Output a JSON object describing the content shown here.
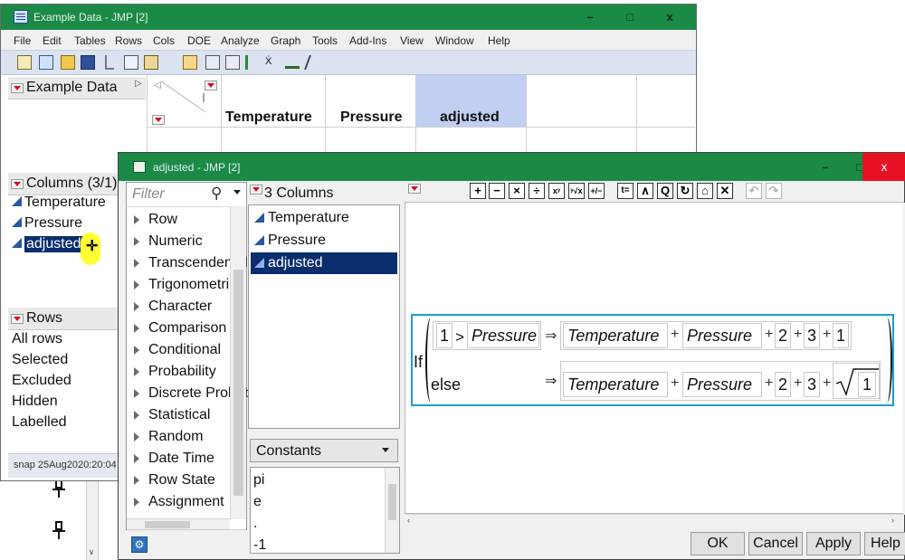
{
  "main_window": {
    "title": "Example Data - JMP [2]",
    "window_controls": {
      "minimize": "–",
      "maximize": "□",
      "close": "x"
    },
    "menu": [
      "File",
      "Edit",
      "Tables",
      "Rows",
      "Cols",
      "DOE",
      "Analyze",
      "Graph",
      "Tools",
      "Add-Ins",
      "View",
      "Window",
      "Help"
    ],
    "table_panel_title": "Example Data",
    "columns_panel_title": "Columns (3/1)",
    "columns": [
      "Temperature",
      "Pressure",
      "adjusted"
    ],
    "rows_panel_title": "Rows",
    "rows_items": [
      "All rows",
      "Selected",
      "Excluded",
      "Hidden",
      "Labelled"
    ],
    "status_text": "snap 25Aug2020:20:04",
    "grid_headers": [
      "Temperature",
      "Pressure",
      "adjusted"
    ]
  },
  "formula_dialog": {
    "title": "adjusted - JMP [2]",
    "window_controls": {
      "minimize": "–",
      "maximize": "□",
      "close": "x"
    },
    "filter_placeholder": "Filter",
    "function_groups": [
      "Row",
      "Numeric",
      "Transcendental",
      "Trigonometric",
      "Character",
      "Comparison",
      "Conditional",
      "Probability",
      "Discrete Probability",
      "Statistical",
      "Random",
      "Date Time",
      "Row State",
      "Assignment"
    ],
    "columns_header": "3 Columns",
    "columns": [
      "Temperature",
      "Pressure",
      "adjusted"
    ],
    "selected_column": "adjusted",
    "constants_label": "Constants",
    "constants": [
      "pi",
      "e",
      ".",
      "-1"
    ],
    "toolbar": [
      "+",
      "−",
      "×",
      "÷",
      "xʸ",
      "ʸ√x",
      "+/−",
      "t=",
      "∧",
      "Q",
      "↻",
      "⌂",
      "✕",
      "undo",
      "redo"
    ],
    "formula": {
      "keyword_if": "If",
      "keyword_else": "else",
      "then_arrow": "⇒",
      "plus": "+",
      "gt": ">",
      "cond_left": "1",
      "cond_right": "Pressure",
      "then_terms": [
        "Temperature",
        "Pressure",
        "2",
        "3",
        "1"
      ],
      "else_terms": [
        "Temperature",
        "Pressure",
        "2",
        "3",
        "1"
      ]
    },
    "buttons": {
      "ok": "OK",
      "cancel": "Cancel",
      "apply": "Apply",
      "help": "Help"
    }
  },
  "colors": {
    "titlebar": "#1b8a47",
    "selection": "#0a2e6e",
    "accent_red": "#d0102c",
    "formula_border": "#1e9ad6",
    "grid_selected": "#c1cff2"
  }
}
